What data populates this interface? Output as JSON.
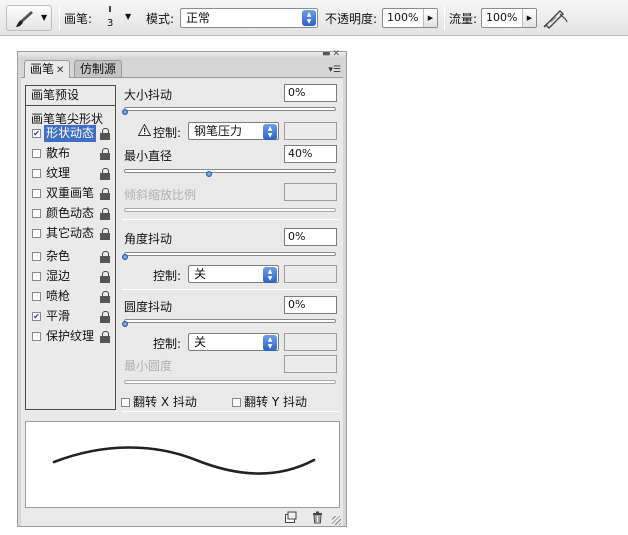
{
  "options_bar": {
    "brush_label": "画笔:",
    "brush_size": "3",
    "mode_label": "模式:",
    "mode_value": "正常",
    "opacity_label": "不透明度:",
    "opacity_value": "100%",
    "flow_label": "流量:",
    "flow_value": "100%"
  },
  "panel": {
    "tab_brushes": "画笔",
    "tab_clone_source": "仿制源",
    "presets_button": "画笔预设",
    "tip_shape": "画笔笔尖形状",
    "items": [
      {
        "label": "形状动态",
        "checked": true,
        "selected": true
      },
      {
        "label": "散布",
        "checked": false
      },
      {
        "label": "纹理",
        "checked": false
      },
      {
        "label": "双重画笔",
        "checked": false
      },
      {
        "label": "颜色动态",
        "checked": false
      },
      {
        "label": "其它动态",
        "checked": false
      },
      {
        "label": "杂色",
        "checked": false
      },
      {
        "label": "湿边",
        "checked": false
      },
      {
        "label": "喷枪",
        "checked": false
      },
      {
        "label": "平滑",
        "checked": true
      },
      {
        "label": "保护纹理",
        "checked": false
      }
    ],
    "size_jitter_label": "大小抖动",
    "size_jitter_value": "0%",
    "size_jitter_level": 0,
    "control_label": "控制:",
    "size_control_value": "钢笔压力",
    "min_diameter_label": "最小直径",
    "min_diameter_value": "40%",
    "min_diameter_level": 0.4,
    "tilt_scale_label": "倾斜缩放比例",
    "angle_jitter_label": "角度抖动",
    "angle_jitter_value": "0%",
    "angle_jitter_level": 0,
    "angle_control_value": "关",
    "roundness_jitter_label": "圆度抖动",
    "roundness_jitter_value": "0%",
    "roundness_jitter_level": 0,
    "roundness_control_value": "关",
    "min_roundness_label": "最小圆度",
    "flip_x_label": "翻转 X 抖动",
    "flip_y_label": "翻转 Y 抖动"
  }
}
